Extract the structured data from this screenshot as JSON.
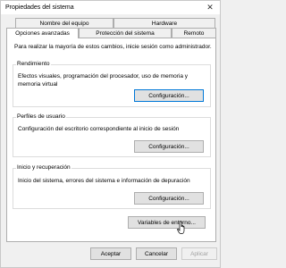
{
  "window": {
    "title": "Propiedades del sistema",
    "close_glyph": "✕"
  },
  "tabs": {
    "row1": [
      {
        "label": "Nombre del equipo"
      },
      {
        "label": "Hardware"
      }
    ],
    "row2": [
      {
        "label": "Opciones avanzadas",
        "active": true
      },
      {
        "label": "Protección del sistema"
      },
      {
        "label": "Remoto"
      }
    ]
  },
  "panel": {
    "intro": "Para realizar la mayoría de estos cambios, inicie sesión como administrador.",
    "groups": [
      {
        "title": "Rendimiento",
        "description": "Efectos visuales, programación del procesador, uso de memoria y memoria virtual",
        "button": "Configuración..."
      },
      {
        "title": "Perfiles de usuario",
        "description": "Configuración del escritorio correspondiente al inicio de sesión",
        "button": "Configuración..."
      },
      {
        "title": "Inicio y recuperación",
        "description": "Inicio del sistema, errores del sistema e información de depuración",
        "button": "Configuración..."
      }
    ],
    "env_button": "Variables de entorno..."
  },
  "footer": {
    "ok": "Aceptar",
    "cancel": "Cancelar",
    "apply": "Aplicar"
  },
  "icons": {
    "cursor": "hand-pointer-icon"
  }
}
